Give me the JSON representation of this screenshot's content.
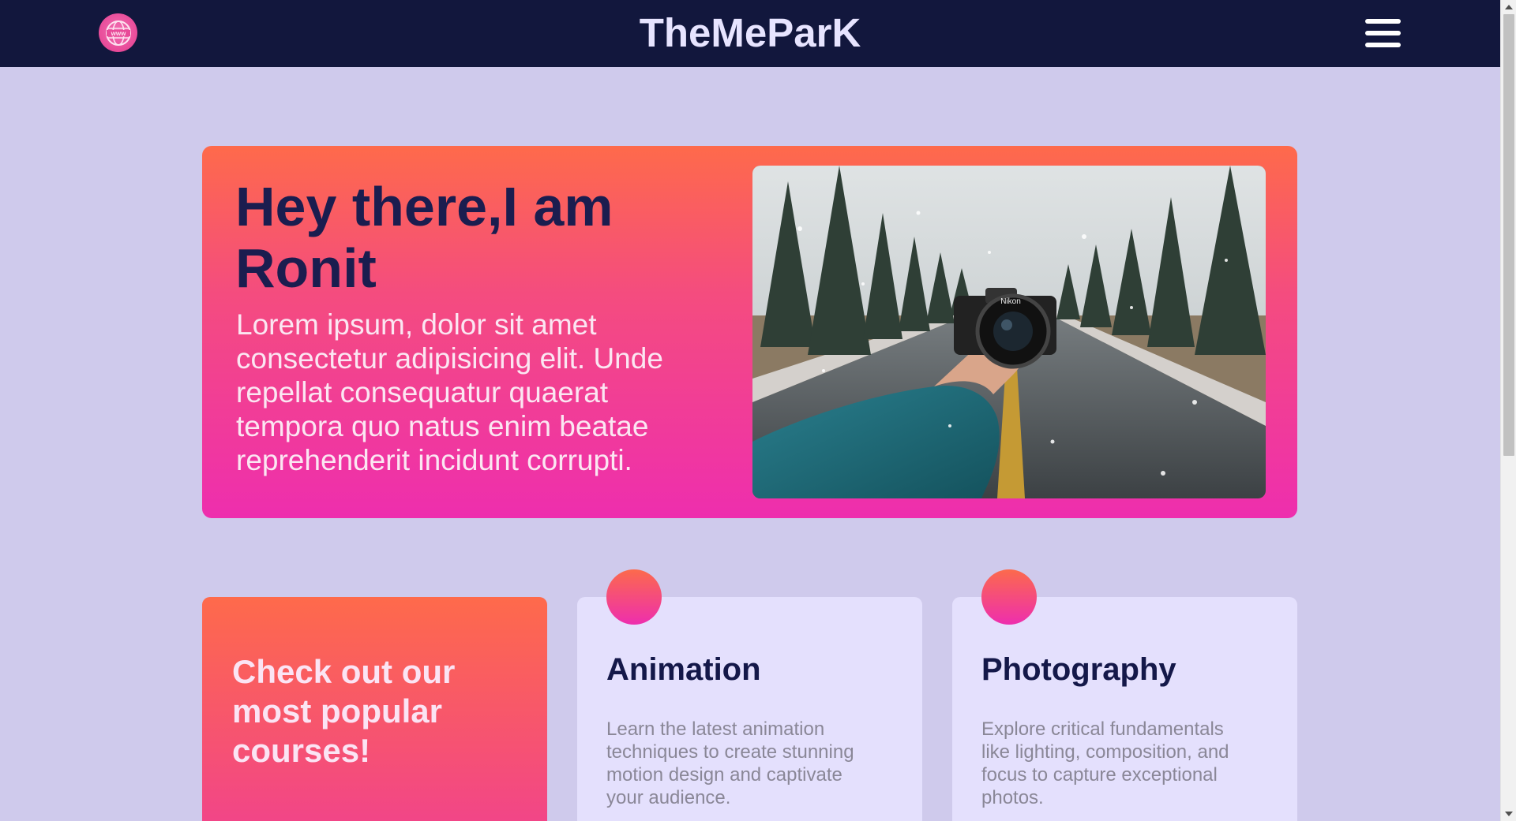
{
  "navbar": {
    "brand": "TheMeParK",
    "logo_icon": "www-globe-icon",
    "menu_icon": "hamburger-menu-icon"
  },
  "hero": {
    "title": "Hey there,I am Ronit",
    "text": "Lorem ipsum, dolor sit amet consectetur adipisicing elit. Unde repellat consequatur quaerat tempora quo natus enim beatae reprehenderit incidunt corrupti.",
    "image_label": "Nikon"
  },
  "courses": {
    "promo": "Check out our most popular courses!",
    "items": [
      {
        "title": "Animation",
        "description": "Learn the latest animation techniques to create stunning motion design and captivate your audience."
      },
      {
        "title": "Photography",
        "description": "Explore critical fundamentals like lighting, composition, and focus to capture exceptional photos."
      }
    ]
  },
  "colors": {
    "navbar_bg": "#12173d",
    "page_bg": "#cfcaec",
    "gradient_top": "#fe6a4b",
    "gradient_bottom": "#ee2eae",
    "card_bg": "#e4e0fd",
    "heading_dark": "#141849"
  }
}
